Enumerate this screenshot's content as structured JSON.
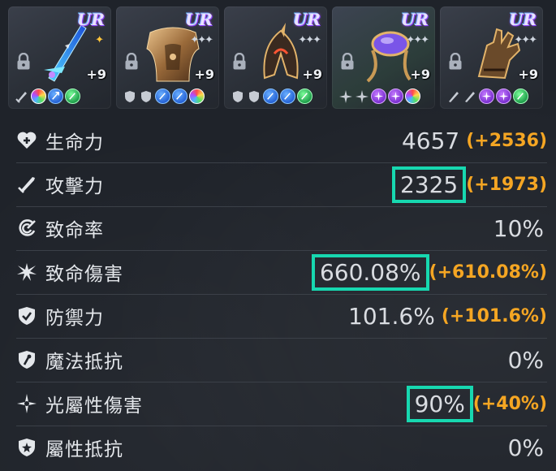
{
  "equipment": [
    {
      "rarity": "UR",
      "stars": "✦",
      "enhance": "+9",
      "gems": [
        "sword-socket",
        "rainbow",
        "blue",
        "green"
      ]
    },
    {
      "rarity": "UR",
      "stars": "✦✦✦",
      "enhance": "+9",
      "gems": [
        "shield-socket",
        "shield-socket",
        "blue",
        "blue",
        "rainbow"
      ]
    },
    {
      "rarity": "UR",
      "stars": "✦✦✦",
      "enhance": "+9",
      "gems": [
        "shield-socket",
        "shield-socket",
        "blue",
        "blue",
        "green"
      ]
    },
    {
      "rarity": "UR",
      "stars": "✦✦✦",
      "enhance": "+9",
      "gems": [
        "burst-socket",
        "burst-socket",
        "purple",
        "purple",
        "rainbow"
      ]
    },
    {
      "rarity": "UR",
      "stars": "✦✦✦",
      "enhance": "+9",
      "gems": [
        "sword-socket",
        "sword-socket",
        "purple",
        "purple",
        "green"
      ]
    }
  ],
  "stats": [
    {
      "icon": "heart-plus-icon",
      "label": "生命力",
      "value": "4657",
      "bonus": "(+2536)",
      "highlight": false
    },
    {
      "icon": "sword-icon",
      "label": "攻擊力",
      "value": "2325",
      "bonus": "(+1973)",
      "highlight": true
    },
    {
      "icon": "crit-swirl-icon",
      "label": "致命率",
      "value": "10%",
      "bonus": "",
      "highlight": false
    },
    {
      "icon": "burst-icon",
      "label": "致命傷害",
      "value": "660.08%",
      "bonus": "(+610.08%)",
      "highlight": true
    },
    {
      "icon": "shield-check-icon",
      "label": "防禦力",
      "value": "101.6%",
      "bonus": "(+101.6%)",
      "highlight": false
    },
    {
      "icon": "magic-shield-icon",
      "label": "魔法抵抗",
      "value": "0%",
      "bonus": "",
      "highlight": false
    },
    {
      "icon": "light-star-icon",
      "label": "光屬性傷害",
      "value": "90%",
      "bonus": "(+40%)",
      "highlight": true
    },
    {
      "icon": "element-shield-icon",
      "label": "屬性抵抗",
      "value": "0%",
      "bonus": "",
      "highlight": false
    }
  ],
  "colors": {
    "background": "#1f232a",
    "bonus": "#f5a623",
    "highlight": "#17d8b0",
    "text": "#d9dce1"
  }
}
